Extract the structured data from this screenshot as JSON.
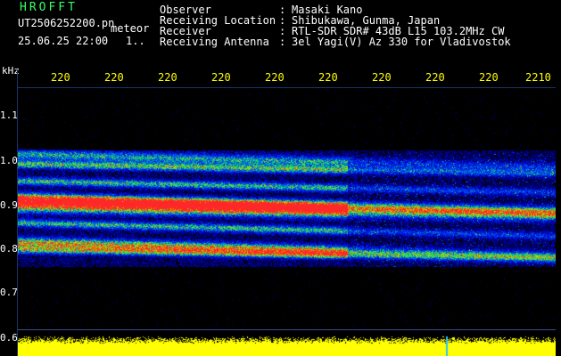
{
  "header": {
    "app_title": "HROFFT",
    "filename": "UT2506252200.pn",
    "mode": "meteor",
    "datetime": "25.06.25 22:00",
    "index": "1..",
    "fields": [
      {
        "label": "Observer",
        "value": "Masaki Kano"
      },
      {
        "label": "Receiving Location",
        "value": "Shibukawa, Gunma, Japan"
      },
      {
        "label": "Receiver",
        "value": "RTL-SDR SDR# 43dB L15 103.2MHz CW"
      },
      {
        "label": "Receiving Antenna",
        "value": "3el Yagi(V) Az 330 for Vladivostok"
      }
    ]
  },
  "axes": {
    "y_unit": "kHz",
    "y_ticks": [
      "1.1",
      "1.0",
      "0.9",
      "0.8",
      "0.7",
      "0.6"
    ],
    "x_ticks": [
      "220",
      "220",
      "220",
      "220",
      "220",
      "220",
      "220",
      "220",
      "220",
      "2210"
    ]
  },
  "chart_data": {
    "type": "heatmap",
    "title": "",
    "xlabel": "",
    "ylabel": "kHz",
    "y_ticks": [
      1.1,
      1.0,
      0.9,
      0.8,
      0.7,
      0.6
    ],
    "ylim": [
      0.6,
      1.2
    ],
    "x_tick_labels": [
      "220",
      "220",
      "220",
      "220",
      "220",
      "220",
      "220",
      "220",
      "220",
      "2210"
    ],
    "colors": {
      "background": "#000000",
      "low": "#0000aa",
      "mid": "#00cc66",
      "high": "#ff3333",
      "power_trace": "#ffff00"
    }
  },
  "colon": ":"
}
